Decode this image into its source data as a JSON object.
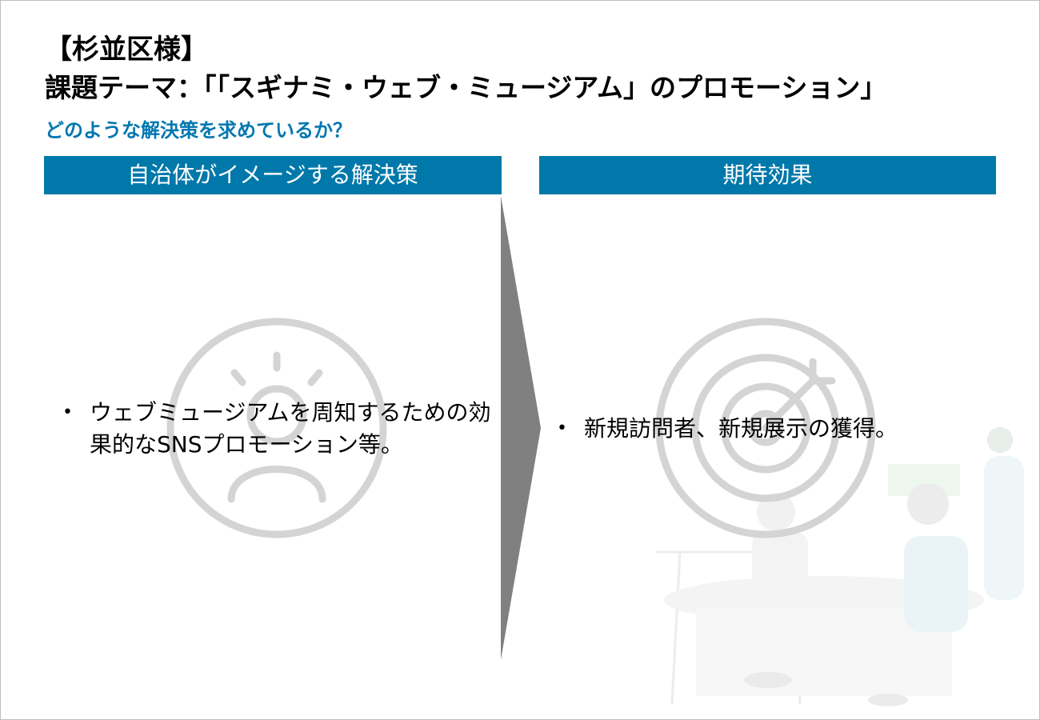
{
  "header": {
    "client": "【杉並区様】",
    "theme": "課題テーマ：「「スギナミ・ウェブ・ミュージアム」のプロモーション」",
    "question": "どのような解決策を求めているか？"
  },
  "columns": {
    "left_title": "自治体がイメージする解決策",
    "right_title": "期待効果"
  },
  "left_bullets": [
    "ウェブミュージアムを周知するための効果的なSNSプロモーション等。"
  ],
  "right_bullets": [
    "新規訪問者、新規展示の獲得。"
  ],
  "bullet_symbol": "•",
  "icons": {
    "left_background": "lightbulb-person-icon",
    "right_background": "target-arrow-icon",
    "divider": "chevron-arrow"
  },
  "colors": {
    "header_bg": "#0078aa",
    "accent_text": "#0077b0",
    "arrow": "#808080",
    "icon_stroke": "#d4d4d4"
  }
}
